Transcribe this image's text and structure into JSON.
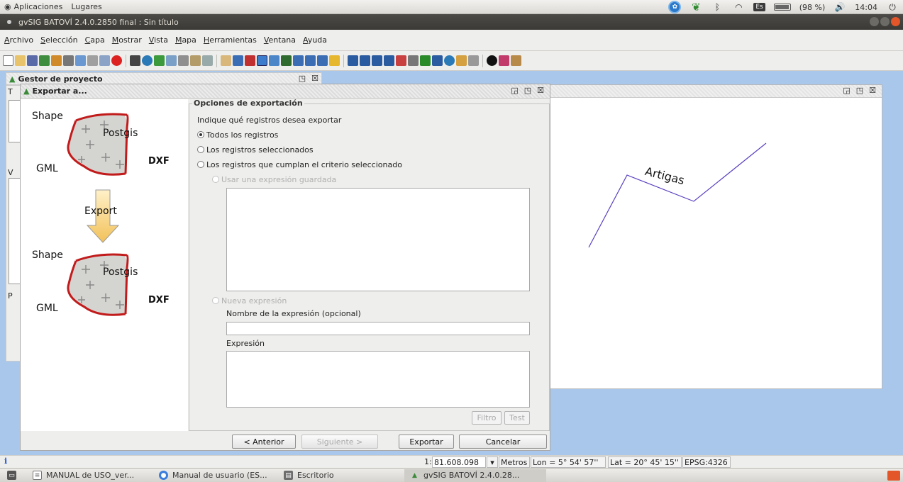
{
  "top_panel": {
    "menu_apps": "Aplicaciones",
    "menu_places": "Lugares",
    "language": "Es",
    "battery": "(98 %)",
    "clock": "14:04"
  },
  "window": {
    "title": "gvSIG BATOVÍ 2.4.0.2850 final : Sin título"
  },
  "menubar": [
    "Archivo",
    "Selección",
    "Capa",
    "Mostrar",
    "Vista",
    "Mapa",
    "Herramientas",
    "Ventana",
    "Ayuda"
  ],
  "project_manager": {
    "title": "Gestor de proyecto",
    "left_letters": [
      "T",
      "V",
      "P"
    ]
  },
  "dialog": {
    "title": "Exportar a...",
    "illustration": {
      "top": {
        "shape": "Shape",
        "postgis": "Postgis",
        "gml": "GML",
        "dxf": "DXF"
      },
      "export_label": "Export",
      "bottom": {
        "shape": "Shape",
        "postgis": "Postgis",
        "gml": "GML",
        "dxf": "DXF"
      }
    },
    "section_title": "Opciones de exportación",
    "question": "Indique qué registros desea exportar",
    "options": {
      "all": "Todos los registros",
      "selected": "Los registros seleccionados",
      "criteria": "Los registros que cumplan el criterio seleccionado",
      "saved_expr": "Usar una expresión guardada",
      "new_expr": "Nueva expresión"
    },
    "expr_name_label": "Nombre de la expresión (opcional)",
    "expr_name_value": "",
    "expr_label": "Expresión",
    "expr_value": "",
    "filter_button": "Filtro",
    "test_button": "Test",
    "buttons": {
      "back": "< Anterior",
      "next": "Siguiente >",
      "export": "Exportar",
      "cancel": "Cancelar"
    }
  },
  "map": {
    "label": "Artigas",
    "line_color": "#5a3fc0"
  },
  "statusbar": {
    "scale_prefix": "1:",
    "scale": "81.608.098",
    "units": "Metros",
    "lon": "Lon = 5° 54' 57''",
    "lat": "Lat = 20° 45' 15''",
    "crs": "EPSG:4326"
  },
  "taskbar": [
    {
      "label": "MANUAL de USO_ver...",
      "icon": "document-icon"
    },
    {
      "label": "Manual de usuario (ES...",
      "icon": "chrome-icon"
    },
    {
      "label": "Escritorio",
      "icon": "folder-icon"
    },
    {
      "label": "gvSIG BATOVÍ 2.4.0.28...",
      "icon": "gvsig-icon"
    }
  ]
}
